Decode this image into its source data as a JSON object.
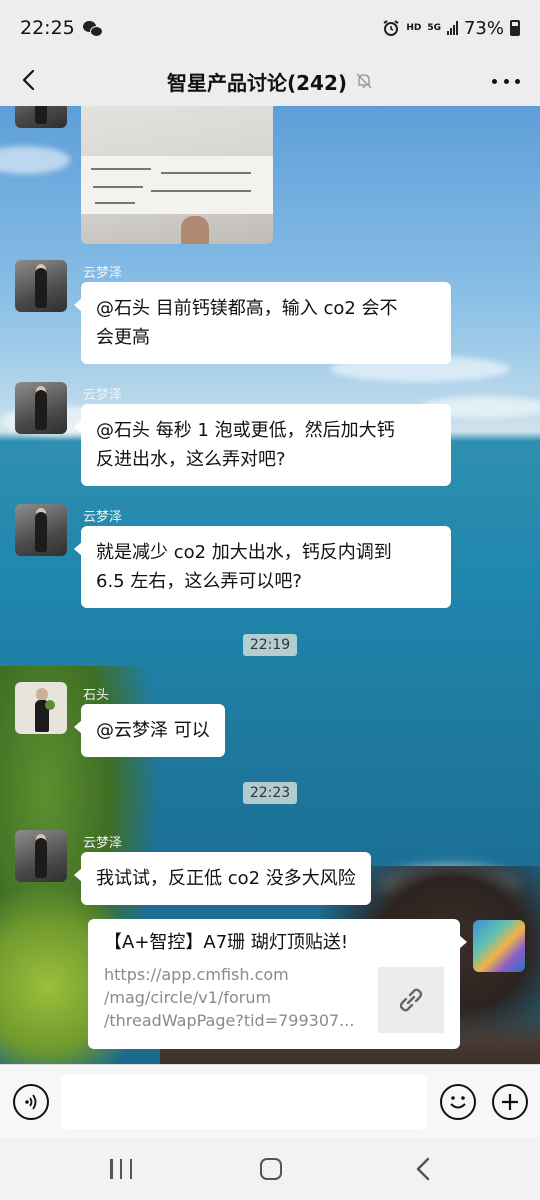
{
  "status_bar": {
    "time": "22:25",
    "battery_percent": "73%",
    "hd_label": "HD",
    "network_label": "5G"
  },
  "nav": {
    "title": "智星产品讨论(242)"
  },
  "messages": [
    {
      "sender": "云梦泽",
      "text_lines": [
        "@石头  目前钙镁都高，输入 co2 会不",
        "会更高"
      ]
    },
    {
      "sender": "云梦泽",
      "text_lines": [
        "@石头  每秒 1 泡或更低，然后加大钙",
        "反进出水，这么弄对吧?"
      ]
    },
    {
      "sender": "云梦泽",
      "text_lines": [
        "就是减少 co2 加大出水，钙反内调到",
        "6.5 左右，这么弄可以吧?"
      ]
    },
    {
      "sender": "石头",
      "text_lines": [
        "@云梦泽  可以"
      ]
    },
    {
      "sender": "云梦泽",
      "text_lines": [
        "我试试，反正低 co2 没多大风险"
      ]
    }
  ],
  "timestamps": [
    "22:19",
    "22:23"
  ],
  "link_card": {
    "title": "【A+智控】A7珊 瑚灯顶贴送!",
    "url_lines": [
      "https://app.cmfish.com",
      "/mag/circle/v1/forum",
      "/threadWapPage?tid=799307..."
    ]
  },
  "input": {
    "placeholder": ""
  },
  "icons": {
    "back": "back-arrow-icon",
    "mute": "bell-muted-icon",
    "more": "more-dots-icon",
    "voice": "voice-icon",
    "emoji": "emoji-icon",
    "plus": "plus-icon",
    "link": "link-icon"
  }
}
